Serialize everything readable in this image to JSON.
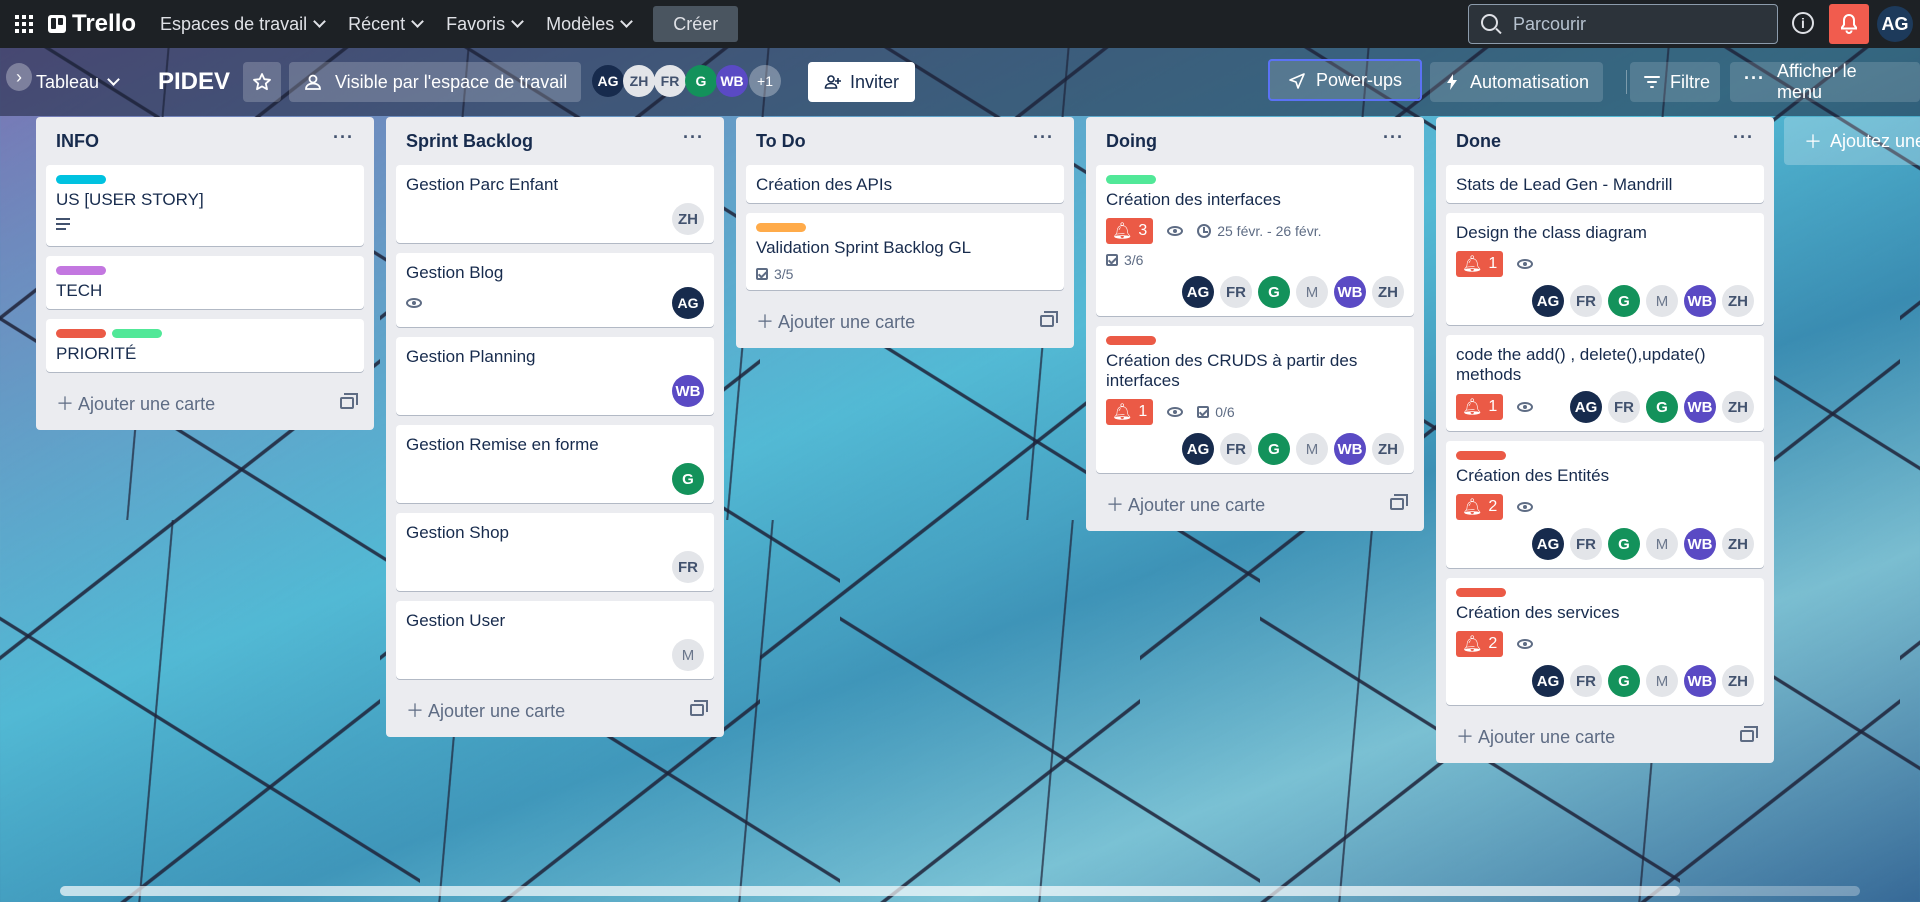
{
  "topbar": {
    "app_name": "Trello",
    "nav": [
      "Espaces de travail",
      "Récent",
      "Favoris",
      "Modèles"
    ],
    "create_label": "Créer",
    "search_placeholder": "Parcourir",
    "user_initials": "AG"
  },
  "board": {
    "view_label": "Tableau",
    "title": "PIDEV",
    "visibility_label": "Visible par l'espace de travail",
    "members": [
      "AG",
      "ZH",
      "FR",
      "G",
      "WB"
    ],
    "more_members": "+1",
    "invite_label": "Inviter",
    "powerups_label": "Power-ups",
    "automation_label": "Automatisation",
    "filter_label": "Filtre",
    "menu_label": "Afficher le menu",
    "add_list_label": "Ajoutez une autre liste",
    "add_card_label": "Ajouter une carte"
  },
  "lists": [
    {
      "title": "INFO",
      "cards": [
        {
          "title": "US [USER STORY]",
          "labels": [
            "#00c2e0"
          ],
          "has_description": true
        },
        {
          "title": "TECH",
          "labels": [
            "#c377e0"
          ]
        },
        {
          "title": "PRIORITÉ",
          "labels": [
            "#eb5a46",
            "#51e898"
          ]
        }
      ]
    },
    {
      "title": "Sprint Backlog",
      "cards": [
        {
          "title": "Gestion Parc Enfant",
          "members": [
            "ZH"
          ]
        },
        {
          "title": "Gestion Blog",
          "watch": true,
          "members": [
            "AG"
          ]
        },
        {
          "title": "Gestion Planning",
          "members": [
            "WB"
          ]
        },
        {
          "title": "Gestion Remise en forme",
          "members": [
            "G"
          ]
        },
        {
          "title": "Gestion Shop",
          "members": [
            "FR"
          ]
        },
        {
          "title": "Gestion User",
          "members": [
            "M"
          ]
        }
      ]
    },
    {
      "title": "To Do",
      "cards": [
        {
          "title": "Création des APIs"
        },
        {
          "title": "Validation Sprint Backlog GL",
          "labels": [
            "#ffab4a"
          ],
          "checklist": "3/5"
        }
      ]
    },
    {
      "title": "Doing",
      "cards": [
        {
          "title": "Création des interfaces",
          "labels": [
            "#51e898"
          ],
          "notifications": "3",
          "watch": true,
          "dates": "25 févr. - 26 févr.",
          "checklist": "3/6",
          "members": [
            "AG",
            "FR",
            "G",
            "M",
            "WB",
            "ZH"
          ]
        },
        {
          "title": "Création des CRUDS à partir des interfaces",
          "labels": [
            "#eb5a46"
          ],
          "notifications": "1",
          "watch": true,
          "checklist": "0/6",
          "members": [
            "AG",
            "FR",
            "G",
            "M",
            "WB",
            "ZH"
          ]
        }
      ]
    },
    {
      "title": "Done",
      "cards": [
        {
          "title": "Stats de Lead Gen - Mandrill"
        },
        {
          "title": "Design the class diagram",
          "notifications": "1",
          "watch": true,
          "members": [
            "AG",
            "FR",
            "G",
            "M",
            "WB",
            "ZH"
          ]
        },
        {
          "title": "code the add() , delete(),update() methods",
          "notifications": "1",
          "watch": true,
          "members": [
            "AG",
            "FR",
            "G",
            "WB",
            "ZH"
          ]
        },
        {
          "title": "Création des Entités",
          "labels": [
            "#eb5a46"
          ],
          "notifications": "2",
          "watch": true,
          "members": [
            "AG",
            "FR",
            "G",
            "M",
            "WB",
            "ZH"
          ]
        },
        {
          "title": "Création des services",
          "labels": [
            "#eb5a46"
          ],
          "notifications": "2",
          "watch": true,
          "members": [
            "AG",
            "FR",
            "G",
            "M",
            "WB",
            "ZH"
          ]
        }
      ]
    }
  ]
}
